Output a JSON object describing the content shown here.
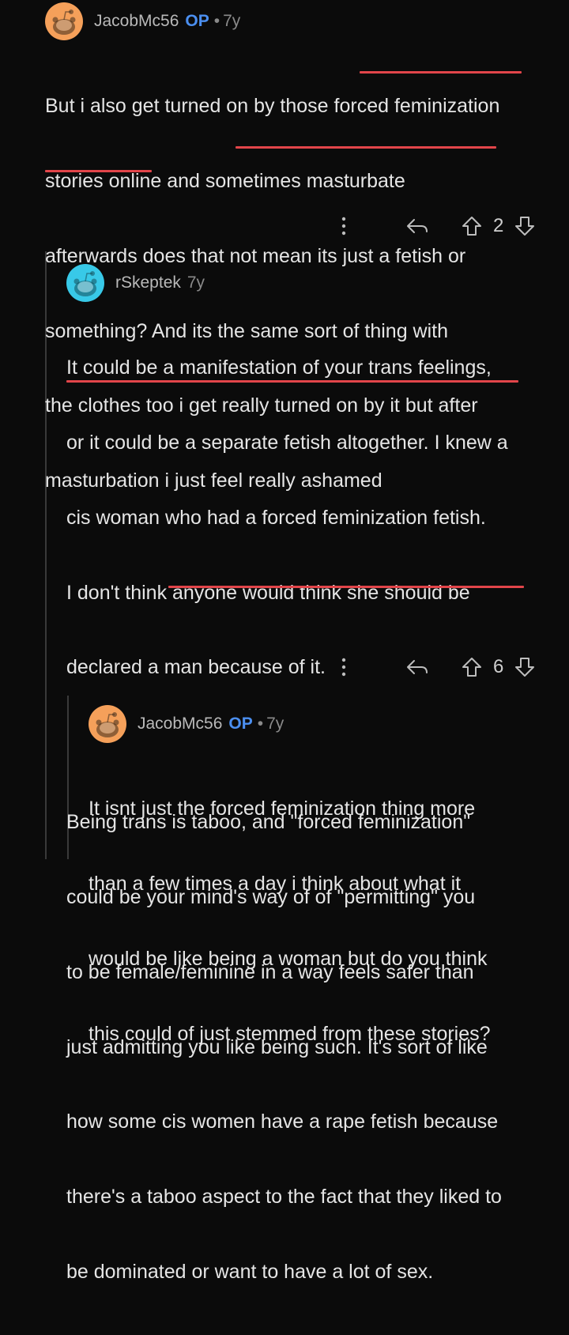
{
  "comments": [
    {
      "username": "JacobMc56",
      "op_badge": "OP",
      "separator": "•",
      "age": "7y",
      "avatar_color": "#f5a05a",
      "lines": [
        "But i also get turned on by those forced feminization",
        "stories online and sometimes masturbate",
        "afterwards does that not mean its just a fetish or",
        "something? And its the same sort of thing with",
        "the clothes too i get really turned on by it but after",
        "masturbation i just feel really ashamed"
      ],
      "votes": "2"
    },
    {
      "username": "rSkeptek",
      "age": "7y",
      "avatar_color": "#38c9e8",
      "lines": [
        "It could be a manifestation of your trans feelings,",
        "or it could be a separate fetish altogether. I knew a",
        "cis woman who had a forced feminization fetish.",
        "I don't think anyone would think she should be",
        "declared a man because of it.",
        "",
        "Being trans is taboo, and \"forced feminization\"",
        "could be your mind's way of of \"permitting\" you",
        "to be female/feminine in a way feels safer than",
        "just admitting you like being such. It's sort of like",
        "how some cis women have a rape fetish because",
        "there's a taboo aspect to the fact that they liked to",
        "be dominated or want to have a lot of sex."
      ],
      "votes": "6"
    },
    {
      "username": "JacobMc56",
      "op_badge": "OP",
      "separator": "•",
      "age": "7y",
      "avatar_color": "#f5a05a",
      "lines": [
        "It isnt just the forced feminization thing more",
        "than a few times a day i think about what it",
        "would be like being a woman but do you think",
        "this could of just stemmed from these stories?"
      ]
    }
  ],
  "colors": {
    "background": "#0b0b0b",
    "op_badge": "#4b8ff0",
    "highlight_underline": "#e2454a"
  },
  "icons": [
    "more-vertical-icon",
    "reply-icon",
    "upvote-icon",
    "downvote-icon",
    "snoo-avatar-icon"
  ]
}
